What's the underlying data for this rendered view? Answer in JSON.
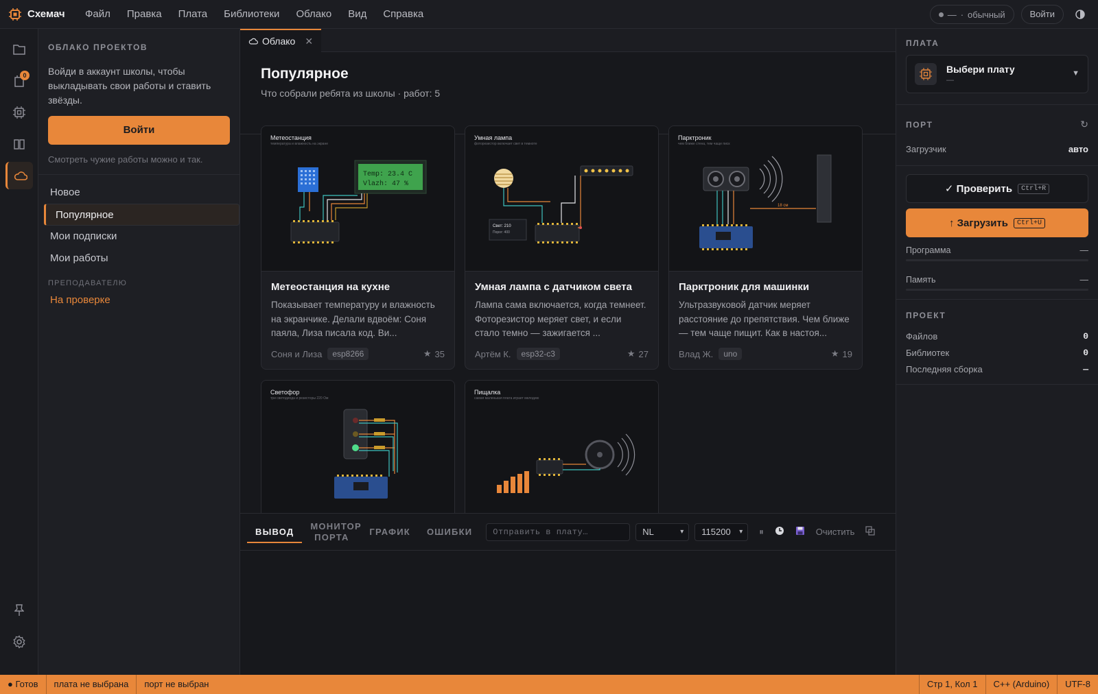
{
  "app": {
    "name": "Схемач"
  },
  "menu": [
    "Файл",
    "Правка",
    "Плата",
    "Библиотеки",
    "Облако",
    "Вид",
    "Справка"
  ],
  "topbar": {
    "mode_dash": "—",
    "mode_label": "обычный",
    "login": "Войти"
  },
  "rail": {
    "badge": "0"
  },
  "sidebar": {
    "title": "ОБЛАКО ПРОЕКТОВ",
    "info": "Войди в аккаунт школы, чтобы выкладывать свои работы и ставить звёзды.",
    "login_button": "Войти",
    "hint": "Смотреть чужие работы можно и так.",
    "nav": [
      "Новое",
      "Популярное",
      "Мои подписки",
      "Мои работы"
    ],
    "teacher_heading": "ПРЕПОДАВАТЕЛЮ",
    "review": "На проверке"
  },
  "tab": {
    "label": "Облако"
  },
  "page": {
    "title": "Популярное",
    "subtitle": "Что собрали ребята из школы · работ: 5"
  },
  "cards": [
    {
      "thumb_title": "Метеостанция",
      "thumb_sub": "температура и влажность на экране",
      "title": "Метеостанция на кухне",
      "desc": "Показывает температуру и влажность на экранчике. Делали вдвоём: Соня паяла, Лиза писала код. Ви...",
      "author": "Соня и Лиза",
      "tag": "esp8266",
      "stars": "35",
      "lcd1": "Temp: 23.4 C",
      "lcd2": "Vlazh: 47 %"
    },
    {
      "thumb_title": "Умная лампа",
      "thumb_sub": "фоторезистор включает свет в темноте",
      "title": "Умная лампа с датчиком света",
      "desc": "Лампа сама включается, когда темнеет. Фоторезистор меряет свет, и если стало темно — зажигается ...",
      "author": "Артём К.",
      "tag": "esp32-c3",
      "stars": "27",
      "readout1": "Свет: 210",
      "readout2": "Порог: 400"
    },
    {
      "thumb_title": "Парктроник",
      "thumb_sub": "чем ближе стена, тем чаще писк",
      "title": "Парктроник для машинки",
      "desc": "Ультразвуковой датчик меряет расстояние до препятствия. Чем ближе — тем чаще пищит. Как в настоя...",
      "author": "Влад Ж.",
      "tag": "uno",
      "stars": "19",
      "dist": "18 см"
    },
    {
      "thumb_title": "Светофор",
      "thumb_sub": "три светодиода и резисторы 220 Ом"
    },
    {
      "thumb_title": "Пищалка",
      "thumb_sub": "самая маленькая плата играет мелодию"
    }
  ],
  "bottom": {
    "tabs": [
      "ВЫВОД",
      "МОНИТОР ПОРТА",
      "ГРАФИК",
      "ОШИБКИ"
    ],
    "send_placeholder": "Отправить в плату…",
    "line_ending": "NL",
    "baud": "115200",
    "clear": "Очистить"
  },
  "right": {
    "board_heading": "ПЛАТА",
    "board_title": "Выбери плату",
    "board_sub": "—",
    "port_heading": "ПОРТ",
    "loader_label": "Загрузчик",
    "loader_value": "авто",
    "check": "✓ Проверить",
    "check_kbd": "Ctrl+R",
    "upload": "↑ Загрузить",
    "upload_kbd": "Ctrl+U",
    "program_label": "Программа",
    "program_value": "—",
    "memory_label": "Память",
    "memory_value": "—",
    "project_heading": "ПРОЕКТ",
    "files_label": "Файлов",
    "files_value": "0",
    "libs_label": "Библиотек",
    "libs_value": "0",
    "build_label": "Последняя сборка",
    "build_value": "—"
  },
  "status": {
    "ready": "● Готов",
    "board": "плата не выбрана",
    "port": "порт не выбран",
    "pos": "Стр 1, Кол 1",
    "lang": "C++ (Arduino)",
    "enc": "UTF-8"
  },
  "colors": {
    "accent": "#e8873a",
    "bg": "#17181c",
    "panel": "#1e1f24"
  }
}
